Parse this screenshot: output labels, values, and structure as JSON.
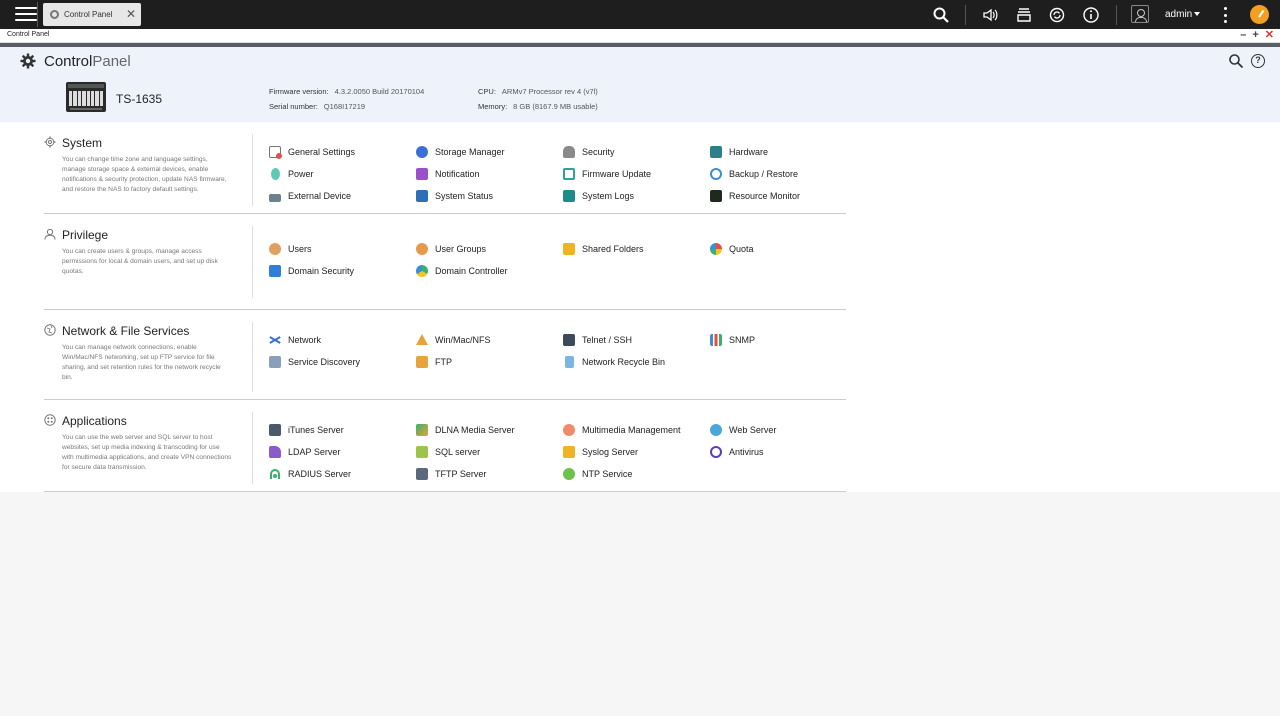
{
  "taskbar": {
    "tab_label": "Control Panel",
    "tab_close": "✕",
    "user": "admin"
  },
  "window": {
    "title": "Control Panel",
    "minimize": "–",
    "maximize": "+",
    "close": "✕"
  },
  "header": {
    "title_bold": "Control",
    "title_light": "Panel",
    "help": "?",
    "model": "TS-1635",
    "firmware_label": "Firmware version:",
    "firmware_value": "4.3.2.0050 Build 20170104",
    "serial_label": "Serial number:",
    "serial_value": "Q168I17219",
    "cpu_label": "CPU:",
    "cpu_value": "ARMv7 Processor rev 4 (v7l)",
    "memory_label": "Memory:",
    "memory_value": "8 GB (8167.9 MB usable)"
  },
  "sections": [
    {
      "title": "System",
      "description": "You can change time zone and language settings, manage storage space & external devices, enable notifications & security protection, update NAS firmware, and restore the NAS to factory default settings.",
      "items": [
        "General Settings",
        "Storage Manager",
        "Security",
        "Hardware",
        "Power",
        "Notification",
        "Firmware Update",
        "Backup / Restore",
        "External Device",
        "System Status",
        "System Logs",
        "Resource Monitor"
      ]
    },
    {
      "title": "Privilege",
      "description": "You can create users & groups, manage access permissions for local & domain users, and set up disk quotas.",
      "items": [
        "Users",
        "User Groups",
        "Shared Folders",
        "Quota",
        "Domain Security",
        "Domain Controller"
      ]
    },
    {
      "title": "Network & File Services",
      "description": "You can manage network connections, enable Win/Mac/NFS networking, set up FTP service for file sharing, and set retention rules for the network recycle bin.",
      "items": [
        "Network",
        "Win/Mac/NFS",
        "Telnet / SSH",
        "SNMP",
        "Service Discovery",
        "FTP",
        "Network Recycle Bin"
      ]
    },
    {
      "title": "Applications",
      "description": "You can use the web server and SQL server to host websites, set up media indexing & transcoding for use with multimedia applications, and create VPN connections for secure data transmission.",
      "items": [
        "iTunes Server",
        "DLNA Media Server",
        "Multimedia Management",
        "Web Server",
        "LDAP Server",
        "SQL server",
        "Syslog Server",
        "Antivirus",
        "RADIUS Server",
        "TFTP Server",
        "NTP Service"
      ]
    }
  ],
  "colors": {
    "taskbar": "#1e1e1e",
    "header_bg": "#eef2fb",
    "accent": "#f3a022"
  }
}
